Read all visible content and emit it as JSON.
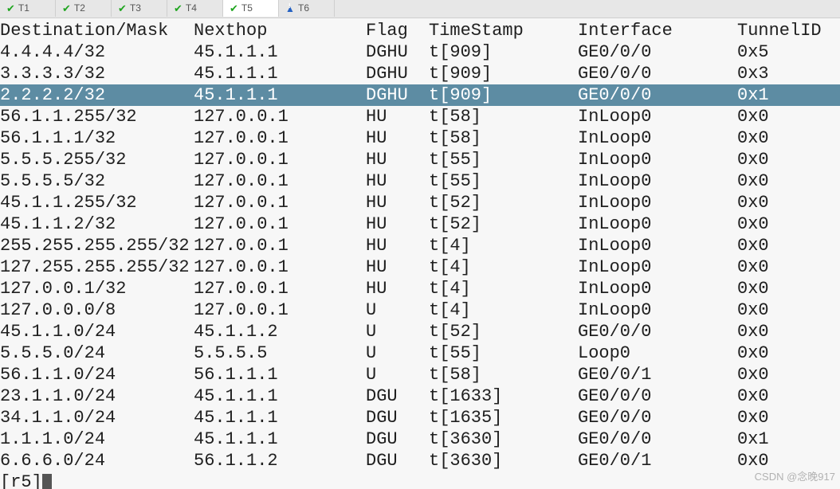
{
  "tabs": [
    {
      "label": "T1",
      "icon": "check",
      "active": false
    },
    {
      "label": "T2",
      "icon": "check",
      "active": false
    },
    {
      "label": "T3",
      "icon": "check",
      "active": false
    },
    {
      "label": "T4",
      "icon": "check",
      "active": false
    },
    {
      "label": "T5",
      "icon": "check",
      "active": true
    },
    {
      "label": "T6",
      "icon": "warn",
      "active": false
    }
  ],
  "headers": {
    "dest": "Destination/Mask",
    "next": "Nexthop",
    "flag": "Flag",
    "ts": "TimeStamp",
    "if": "Interface",
    "tid": "TunnelID"
  },
  "rows": [
    {
      "dest": "4.4.4.4/32",
      "next": "45.1.1.1",
      "flag": "DGHU",
      "ts": "t[909]",
      "if": "GE0/0/0",
      "tid": "0x5",
      "selected": false
    },
    {
      "dest": "3.3.3.3/32",
      "next": "45.1.1.1",
      "flag": "DGHU",
      "ts": "t[909]",
      "if": "GE0/0/0",
      "tid": "0x3",
      "selected": false
    },
    {
      "dest": "2.2.2.2/32",
      "next": "45.1.1.1",
      "flag": "DGHU",
      "ts": "t[909]",
      "if": "GE0/0/0",
      "tid": "0x1",
      "selected": true
    },
    {
      "dest": "56.1.1.255/32",
      "next": "127.0.0.1",
      "flag": "HU",
      "ts": "t[58]",
      "if": "InLoop0",
      "tid": "0x0",
      "selected": false
    },
    {
      "dest": "56.1.1.1/32",
      "next": "127.0.0.1",
      "flag": "HU",
      "ts": "t[58]",
      "if": "InLoop0",
      "tid": "0x0",
      "selected": false
    },
    {
      "dest": "5.5.5.255/32",
      "next": "127.0.0.1",
      "flag": "HU",
      "ts": "t[55]",
      "if": "InLoop0",
      "tid": "0x0",
      "selected": false
    },
    {
      "dest": "5.5.5.5/32",
      "next": "127.0.0.1",
      "flag": "HU",
      "ts": "t[55]",
      "if": "InLoop0",
      "tid": "0x0",
      "selected": false
    },
    {
      "dest": "45.1.1.255/32",
      "next": "127.0.0.1",
      "flag": "HU",
      "ts": "t[52]",
      "if": "InLoop0",
      "tid": "0x0",
      "selected": false
    },
    {
      "dest": "45.1.1.2/32",
      "next": "127.0.0.1",
      "flag": "HU",
      "ts": "t[52]",
      "if": "InLoop0",
      "tid": "0x0",
      "selected": false
    },
    {
      "dest": "255.255.255.255/32",
      "next": "127.0.0.1",
      "flag": "HU",
      "ts": "t[4]",
      "if": "InLoop0",
      "tid": "0x0",
      "selected": false
    },
    {
      "dest": "127.255.255.255/32",
      "next": "127.0.0.1",
      "flag": "HU",
      "ts": "t[4]",
      "if": "InLoop0",
      "tid": "0x0",
      "selected": false
    },
    {
      "dest": "127.0.0.1/32",
      "next": "127.0.0.1",
      "flag": "HU",
      "ts": "t[4]",
      "if": "InLoop0",
      "tid": "0x0",
      "selected": false
    },
    {
      "dest": "127.0.0.0/8",
      "next": "127.0.0.1",
      "flag": "U",
      "ts": "t[4]",
      "if": "InLoop0",
      "tid": "0x0",
      "selected": false
    },
    {
      "dest": "45.1.1.0/24",
      "next": "45.1.1.2",
      "flag": "U",
      "ts": "t[52]",
      "if": "GE0/0/0",
      "tid": "0x0",
      "selected": false
    },
    {
      "dest": "5.5.5.0/24",
      "next": "5.5.5.5",
      "flag": "U",
      "ts": "t[55]",
      "if": "Loop0",
      "tid": "0x0",
      "selected": false
    },
    {
      "dest": "56.1.1.0/24",
      "next": "56.1.1.1",
      "flag": "U",
      "ts": "t[58]",
      "if": "GE0/0/1",
      "tid": "0x0",
      "selected": false
    },
    {
      "dest": "23.1.1.0/24",
      "next": "45.1.1.1",
      "flag": "DGU",
      "ts": "t[1633]",
      "if": "GE0/0/0",
      "tid": "0x0",
      "selected": false
    },
    {
      "dest": "34.1.1.0/24",
      "next": "45.1.1.1",
      "flag": "DGU",
      "ts": "t[1635]",
      "if": "GE0/0/0",
      "tid": "0x0",
      "selected": false
    },
    {
      "dest": "1.1.1.0/24",
      "next": "45.1.1.1",
      "flag": "DGU",
      "ts": "t[3630]",
      "if": "GE0/0/0",
      "tid": "0x1",
      "selected": false
    },
    {
      "dest": "6.6.6.0/24",
      "next": "56.1.1.2",
      "flag": "DGU",
      "ts": "t[3630]",
      "if": "GE0/0/1",
      "tid": "0x0",
      "selected": false
    }
  ],
  "prompt": "[r5]",
  "watermark": "CSDN @念晚917"
}
